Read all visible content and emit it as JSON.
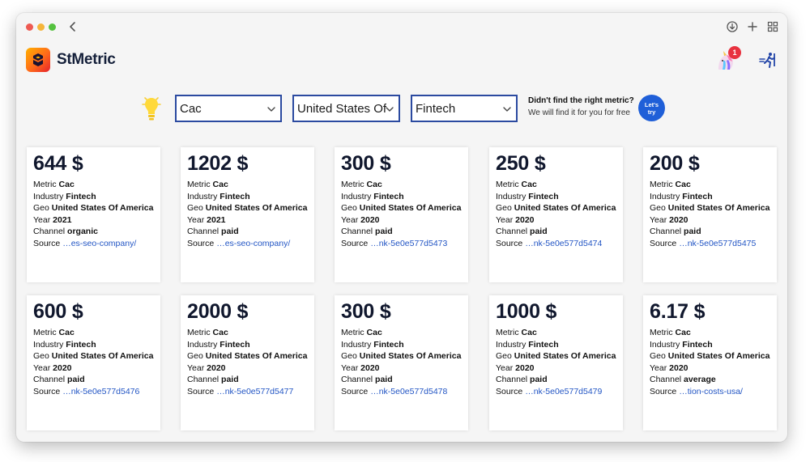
{
  "app": {
    "name": "StMetric"
  },
  "header": {
    "notification_count": "1"
  },
  "filters": {
    "metric": "Cac",
    "geo": "United States Of",
    "industry": "Fintech"
  },
  "cta": {
    "title": "Didn't find the right metric?",
    "subtitle": "We will find it for you for free",
    "button_label": "Let's try"
  },
  "labels": {
    "metric": "Metric",
    "industry": "Industry",
    "geo": "Geo",
    "year": "Year",
    "channel": "Channel",
    "source": "Source"
  },
  "cards": [
    {
      "price": "644 $",
      "metric": "Cac",
      "industry": "Fintech",
      "geo": "United States Of America",
      "year": "2021",
      "channel": "organic",
      "source": "…es-seo-company/"
    },
    {
      "price": "1202 $",
      "metric": "Cac",
      "industry": "Fintech",
      "geo": "United States Of America",
      "year": "2021",
      "channel": "paid",
      "source": "…es-seo-company/"
    },
    {
      "price": "300 $",
      "metric": "Cac",
      "industry": "Fintech",
      "geo": "United States Of America",
      "year": "2020",
      "channel": "paid",
      "source": "…nk-5e0e577d5473"
    },
    {
      "price": "250 $",
      "metric": "Cac",
      "industry": "Fintech",
      "geo": "United States Of America",
      "year": "2020",
      "channel": "paid",
      "source": "…nk-5e0e577d5474"
    },
    {
      "price": "200 $",
      "metric": "Cac",
      "industry": "Fintech",
      "geo": "United States Of America",
      "year": "2020",
      "channel": "paid",
      "source": "…nk-5e0e577d5475"
    },
    {
      "price": "600 $",
      "metric": "Cac",
      "industry": "Fintech",
      "geo": "United States Of America",
      "year": "2020",
      "channel": "paid",
      "source": "…nk-5e0e577d5476"
    },
    {
      "price": "2000 $",
      "metric": "Cac",
      "industry": "Fintech",
      "geo": "United States Of America",
      "year": "2020",
      "channel": "paid",
      "source": "…nk-5e0e577d5477"
    },
    {
      "price": "300 $",
      "metric": "Cac",
      "industry": "Fintech",
      "geo": "United States Of America",
      "year": "2020",
      "channel": "paid",
      "source": "…nk-5e0e577d5478"
    },
    {
      "price": "1000 $",
      "metric": "Cac",
      "industry": "Fintech",
      "geo": "United States Of America",
      "year": "2020",
      "channel": "paid",
      "source": "…nk-5e0e577d5479"
    },
    {
      "price": "6.17 $",
      "metric": "Cac",
      "industry": "Fintech",
      "geo": "United States Of America",
      "year": "2020",
      "channel": "average",
      "source": "…tion-costs-usa/"
    }
  ],
  "colors": {
    "accent": "#2b4aa0",
    "cta_button": "#1f5fd8",
    "link": "#2255c4",
    "badge": "#e8323f",
    "text_dark": "#10172d"
  },
  "icons": {
    "back": "chevron-left-icon",
    "download": "download-icon",
    "new_tab": "plus-icon",
    "tabs_overview": "grid-icon",
    "logo": "stmetric-logo-icon",
    "avatar": "unicorn-icon",
    "logout": "exit-icon",
    "idea": "lightbulb-icon",
    "dropdown": "chevron-down-icon"
  }
}
